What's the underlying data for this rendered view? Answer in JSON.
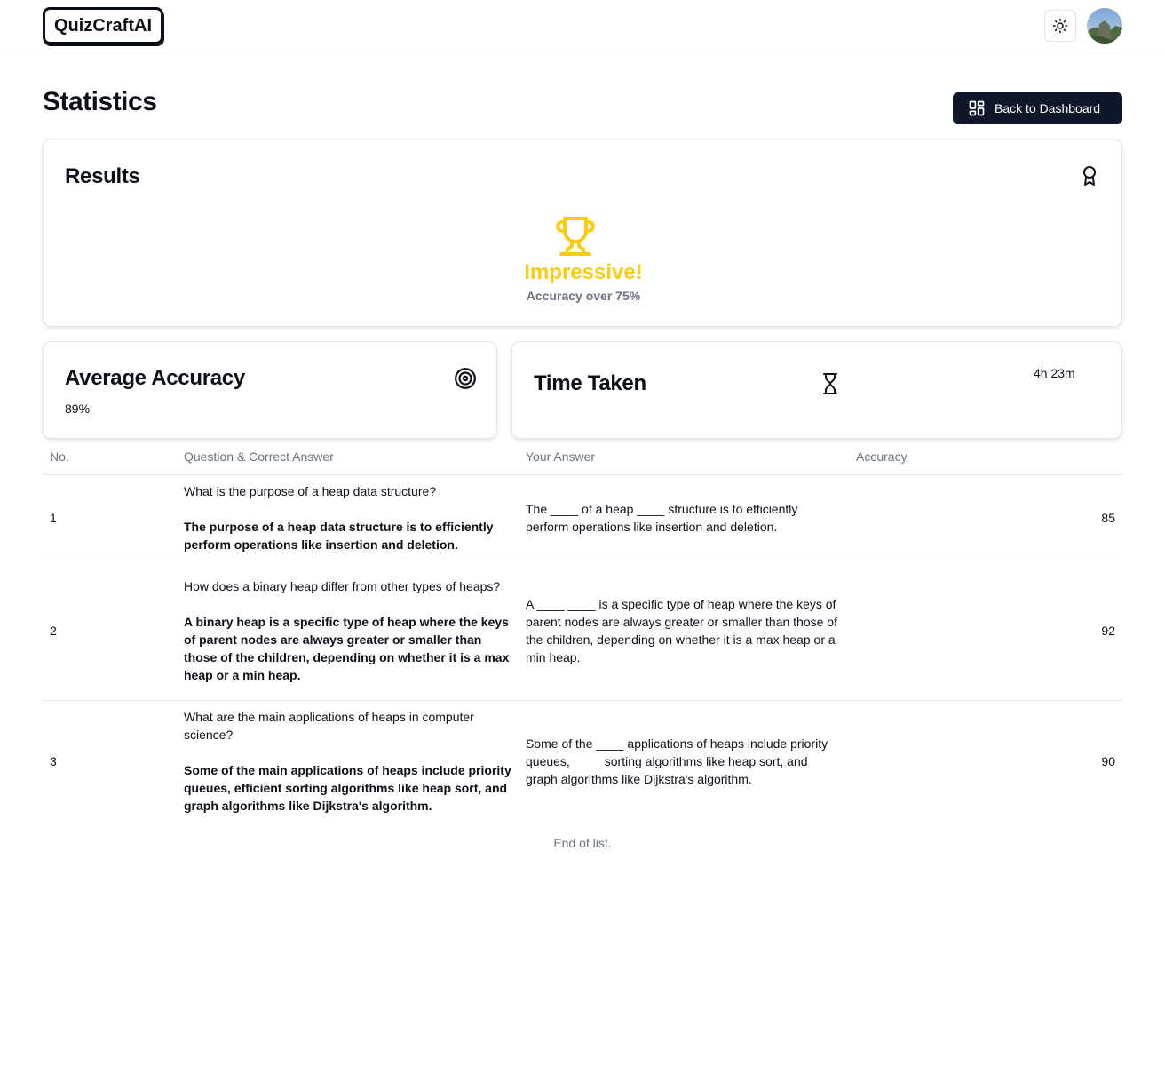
{
  "header": {
    "logo": "QuizCraftAI",
    "theme_toggle_icon": "sun-icon",
    "avatar_icon": "user-avatar"
  },
  "page": {
    "title": "Statistics",
    "back_button": "Back to Dashboard",
    "back_icon": "layout-dashboard-icon"
  },
  "results": {
    "title": "Results",
    "icon": "award-icon",
    "headline_icon": "trophy-icon",
    "headline": "Impressive!",
    "subtext": "Accuracy over 75%",
    "accent_color": "#facc15"
  },
  "accuracy_card": {
    "title": "Average Accuracy",
    "icon": "target-icon",
    "value": "89%"
  },
  "time_card": {
    "title": "Time Taken",
    "icon": "hourglass-icon",
    "value": "4h 23m"
  },
  "table": {
    "headers": [
      "No.",
      "Question & Correct Answer",
      "Your Answer",
      "Accuracy"
    ],
    "rows": [
      {
        "no": "1",
        "question": "What is the purpose of a heap data structure?",
        "correct_answer": "The purpose of a heap data structure is to efficiently perform operations like insertion and deletion.",
        "user_answer": "The ____ of a heap ____ structure is to efficiently perform operations like insertion and deletion.",
        "accuracy": "85"
      },
      {
        "no": "2",
        "question": "How does a binary heap differ from other types of heaps?",
        "correct_answer": "A binary heap is a specific type of heap where the keys of parent nodes are always greater or smaller than those of the children, depending on whether it is a max heap or a min heap.",
        "user_answer": "A ____ ____ is a specific type of heap where the keys of parent nodes are always greater or smaller than those of the children, depending on whether it is a max heap or a min heap.",
        "accuracy": "92"
      },
      {
        "no": "3",
        "question": "What are the main applications of heaps in computer science?",
        "correct_answer": "Some of the main applications of heaps include priority queues, efficient sorting algorithms like heap sort, and graph algorithms like Dijkstra's algorithm.",
        "user_answer": "Some of the ____ applications of heaps include priority queues, ____ sorting algorithms like heap sort, and graph algorithms like Dijkstra's algorithm.",
        "accuracy": "90"
      }
    ],
    "footer": "End of list."
  }
}
